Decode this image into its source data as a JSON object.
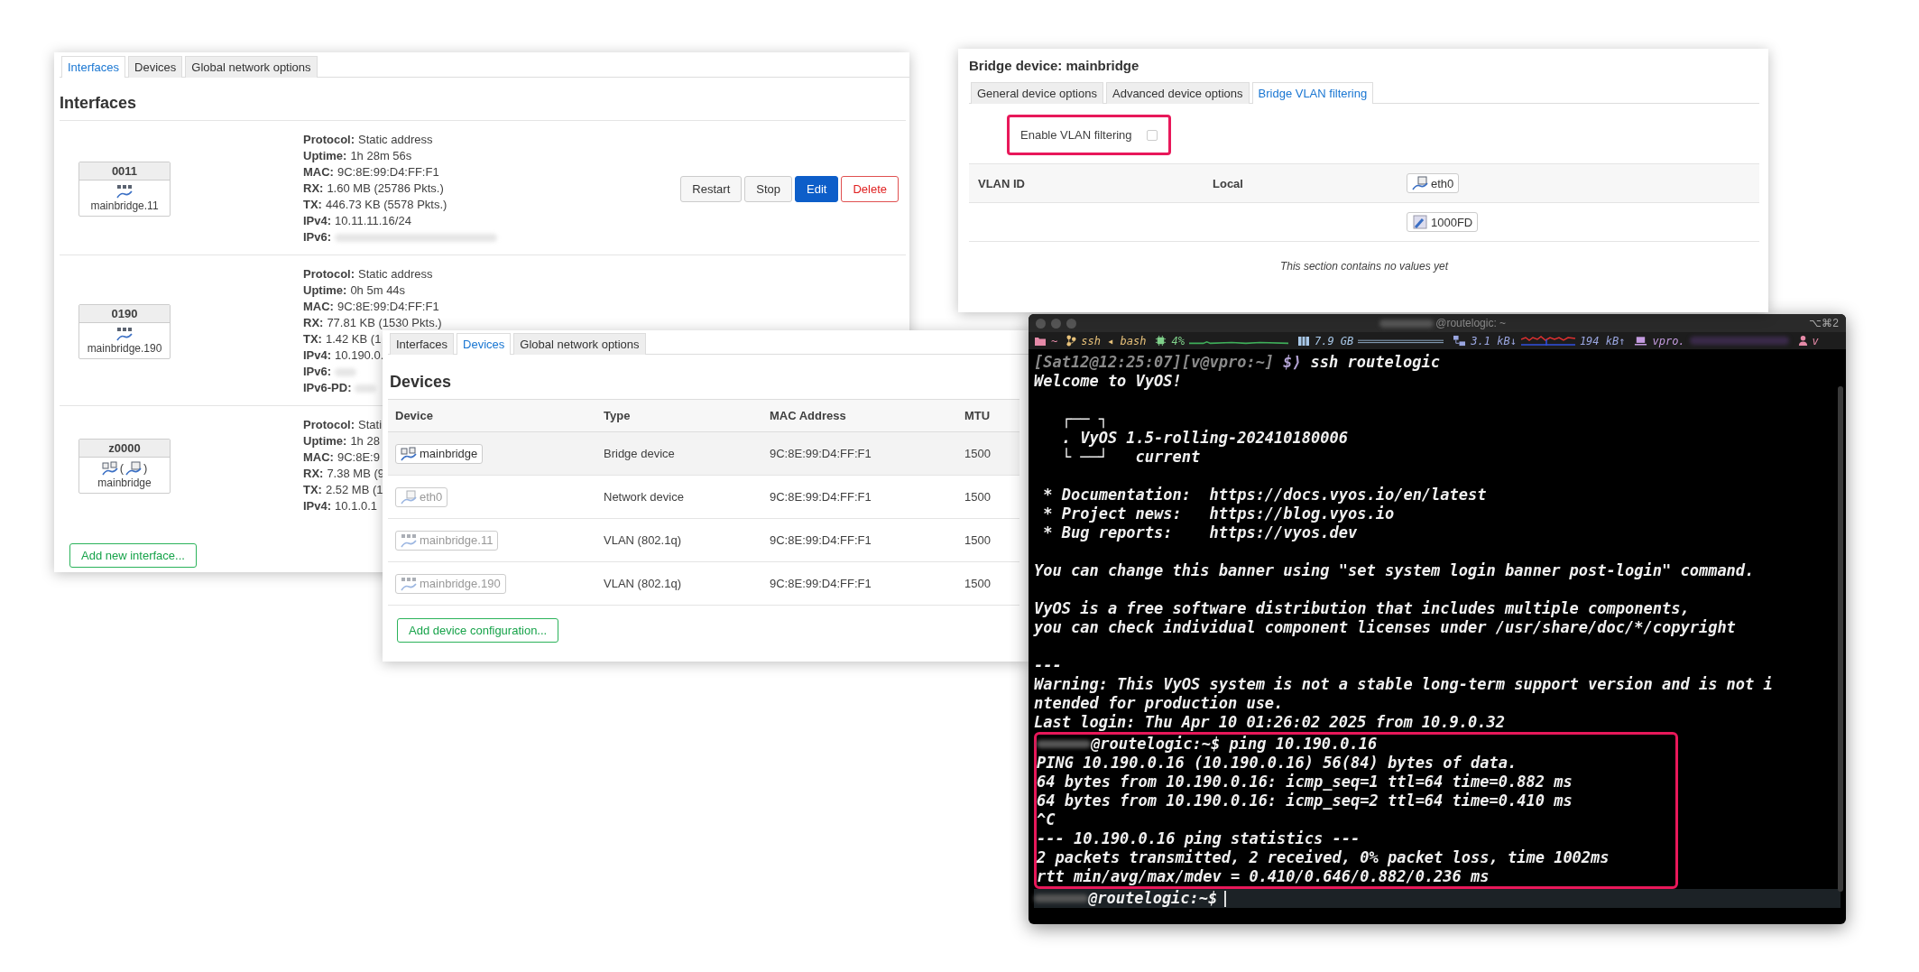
{
  "interfaces_window": {
    "tabs": [
      {
        "label": "Interfaces",
        "selected": true
      },
      {
        "label": "Devices",
        "selected": false
      },
      {
        "label": "Global network options",
        "selected": false
      }
    ],
    "heading": "Interfaces",
    "rows": [
      {
        "name": "0011",
        "icons": [
          {
            "kind": "vlan"
          }
        ],
        "device": "mainbridge.11",
        "details": [
          {
            "label": "Protocol:",
            "value": "Static address"
          },
          {
            "label": "Uptime:",
            "value": "1h 28m 56s"
          },
          {
            "label": "MAC:",
            "value": "9C:8E:99:D4:FF:F1"
          },
          {
            "label": "RX:",
            "value": "1.60 MB (25786 Pkts.)"
          },
          {
            "label": "TX:",
            "value": "446.73 KB (5578 Pkts.)"
          },
          {
            "label": "IPv4:",
            "value": "10.11.11.16/24"
          },
          {
            "label": "IPv6:",
            "blurred": true
          }
        ],
        "buttons": [
          {
            "label": "Restart",
            "kind": "default"
          },
          {
            "label": "Stop",
            "kind": "default"
          },
          {
            "label": "Edit",
            "kind": "primary"
          },
          {
            "label": "Delete",
            "kind": "danger"
          }
        ]
      },
      {
        "name": "0190",
        "icons": [
          {
            "kind": "vlan"
          }
        ],
        "device": "mainbridge.190",
        "details": [
          {
            "label": "Protocol:",
            "value": "Static address"
          },
          {
            "label": "Uptime:",
            "value": "0h 5m 44s"
          },
          {
            "label": "MAC:",
            "value": "9C:8E:99:D4:FF:F1"
          },
          {
            "label": "RX:",
            "value": "77.81 KB (1530 Pkts.)"
          },
          {
            "label": "TX:",
            "value": "1.42 KB (1"
          },
          {
            "label": "IPv4:",
            "value": "10.190.0."
          },
          {
            "label": "IPv6:",
            "blurred": true
          },
          {
            "label": "IPv6-PD:",
            "blurred": true
          }
        ]
      },
      {
        "name": "z0000",
        "icons": [
          {
            "kind": "bridge"
          },
          {
            "kind": "ethernet",
            "open": "(",
            "close": ")"
          }
        ],
        "device": "mainbridge",
        "details": [
          {
            "label": "Protocol:",
            "value": "Stati"
          },
          {
            "label": "Uptime:",
            "value": "1h 28"
          },
          {
            "label": "MAC:",
            "value": "9C:8E:9"
          },
          {
            "label": "RX:",
            "value": "7.38 MB (9"
          },
          {
            "label": "TX:",
            "value": "2.52 MB (1"
          },
          {
            "label": "IPv4:",
            "value": "10.1.0.1"
          }
        ]
      }
    ],
    "add_button": "Add new interface..."
  },
  "devices_window": {
    "tabs": [
      {
        "label": "Interfaces",
        "selected": false
      },
      {
        "label": "Devices",
        "selected": true
      },
      {
        "label": "Global network options",
        "selected": false
      }
    ],
    "heading": "Devices",
    "columns": [
      "Device",
      "Type",
      "MAC Address",
      "MTU"
    ],
    "rows": [
      {
        "device": "mainbridge",
        "kind": "bridge",
        "dimmed": false,
        "hovered": true,
        "type": "Bridge device",
        "mac": "9C:8E:99:D4:FF:F1",
        "mtu": "1500"
      },
      {
        "device": "eth0",
        "kind": "ethernet",
        "dimmed": true,
        "hovered": false,
        "type": "Network device",
        "mac": "9C:8E:99:D4:FF:F1",
        "mtu": "1500"
      },
      {
        "device": "mainbridge.11",
        "kind": "vlan",
        "dimmed": true,
        "hovered": false,
        "type": "VLAN (802.1q)",
        "mac": "9C:8E:99:D4:FF:F1",
        "mtu": "1500"
      },
      {
        "device": "mainbridge.190",
        "kind": "vlan",
        "dimmed": true,
        "hovered": false,
        "type": "VLAN (802.1q)",
        "mac": "9C:8E:99:D4:FF:F1",
        "mtu": "1500"
      }
    ],
    "add_button": "Add device configuration..."
  },
  "bridge_window": {
    "title": "Bridge device: mainbridge",
    "tabs": [
      {
        "label": "General device options",
        "selected": false
      },
      {
        "label": "Advanced device options",
        "selected": false
      },
      {
        "label": "Bridge VLAN filtering",
        "selected": true
      }
    ],
    "option": {
      "label": "Enable VLAN filtering",
      "checked": false,
      "highlighted": true
    },
    "columns": [
      "VLAN ID",
      "Local"
    ],
    "port": {
      "label": "eth0",
      "kind": "ethernet"
    },
    "port_speed": {
      "label": "1000FD",
      "kind": "cable"
    },
    "empty_note": "This section contains no values yet"
  },
  "terminal": {
    "title": "@routelogic: ~",
    "shortcut": "⌥⌘2",
    "status": [
      {
        "kind": "folder",
        "text": "~",
        "color": "#e58aa8"
      },
      {
        "kind": "branch",
        "text": "ssh ◂ bash",
        "color": "#e8c27a"
      },
      {
        "kind": "cpu",
        "text": "4%",
        "color": "#7fd08a"
      },
      {
        "kind": "memory",
        "text": "7.9 GB",
        "color": "#a8c8e8"
      },
      {
        "kind": "network",
        "text": "3.1 kB↓",
        "text2": "194 kB↑",
        "color": "#9aa6e0"
      },
      {
        "kind": "host",
        "text": "vpro.",
        "color": "#c49be0"
      },
      {
        "kind": "user",
        "text": "v",
        "color": "#e58aa8"
      }
    ],
    "lines": [
      {
        "kind": "ps1",
        "prompt": "[Sat12@12:25:07][v@vpro:~]",
        "symbol": "$⟩",
        "command": "ssh routelogic"
      },
      {
        "kind": "out",
        "text": "Welcome to VyOS!"
      },
      {
        "kind": "blank"
      },
      {
        "kind": "out",
        "text": "   ┌── ┐"
      },
      {
        "kind": "out",
        "text": "   . VyOS 1.5-rolling-202410180006"
      },
      {
        "kind": "out",
        "text": "   └ ──┘   current"
      },
      {
        "kind": "blank"
      },
      {
        "kind": "out",
        "text": " * Documentation:  https://docs.vyos.io/en/latest"
      },
      {
        "kind": "out",
        "text": " * Project news:   https://blog.vyos.io"
      },
      {
        "kind": "out",
        "text": " * Bug reports:    https://vyos.dev"
      },
      {
        "kind": "blank"
      },
      {
        "kind": "out",
        "text": "You can change this banner using \"set system login banner post-login\" command."
      },
      {
        "kind": "blank"
      },
      {
        "kind": "out",
        "text": "VyOS is a free software distribution that includes multiple components,"
      },
      {
        "kind": "out",
        "text": "you can check individual component licenses under /usr/share/doc/*/copyright"
      },
      {
        "kind": "blank"
      },
      {
        "kind": "out",
        "text": "---"
      },
      {
        "kind": "out",
        "text": "Warning: This VyOS system is not a stable long-term support version and is not i"
      },
      {
        "kind": "out",
        "text": "ntended for production use."
      },
      {
        "kind": "out",
        "text": "Last login: Thu Apr 10 01:26:02 2025 from 10.9.0.32"
      }
    ],
    "highlighted": [
      {
        "kind": "prompt",
        "text": "@routelogic:~$ ping 10.190.0.16"
      },
      {
        "kind": "out",
        "text": "PING 10.190.0.16 (10.190.0.16) 56(84) bytes of data."
      },
      {
        "kind": "out",
        "text": "64 bytes from 10.190.0.16: icmp_seq=1 ttl=64 time=0.882 ms"
      },
      {
        "kind": "out",
        "text": "64 bytes from 10.190.0.16: icmp_seq=2 ttl=64 time=0.410 ms"
      },
      {
        "kind": "out",
        "text": "^C"
      },
      {
        "kind": "out",
        "text": "--- 10.190.0.16 ping statistics ---"
      },
      {
        "kind": "out",
        "text": "2 packets transmitted, 2 received, 0% packet loss, time 1002ms"
      },
      {
        "kind": "out",
        "text": "rtt min/avg/max/mdev = 0.410/0.646/0.882/0.236 ms"
      }
    ],
    "after": [
      {
        "kind": "input",
        "text": "@routelogic:~$"
      }
    ]
  }
}
